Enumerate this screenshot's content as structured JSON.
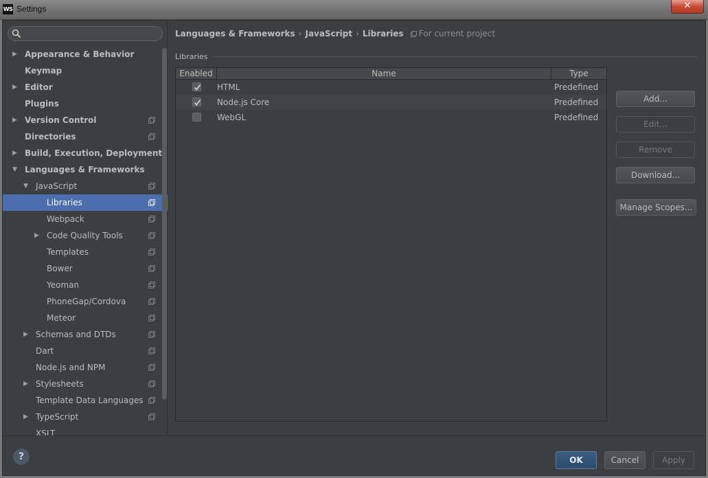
{
  "window": {
    "title": "Settings",
    "logo_text": "WS",
    "close_label": "✕"
  },
  "sidebar": {
    "search_placeholder": "",
    "items": [
      {
        "label": "Appearance & Behavior",
        "level": 0,
        "arrow": "right",
        "bold": true,
        "project": false
      },
      {
        "label": "Keymap",
        "level": 0,
        "arrow": "",
        "bold": true,
        "project": false
      },
      {
        "label": "Editor",
        "level": 0,
        "arrow": "right",
        "bold": true,
        "project": false
      },
      {
        "label": "Plugins",
        "level": 0,
        "arrow": "",
        "bold": true,
        "project": false
      },
      {
        "label": "Version Control",
        "level": 0,
        "arrow": "right",
        "bold": true,
        "project": true
      },
      {
        "label": "Directories",
        "level": 0,
        "arrow": "",
        "bold": true,
        "project": true
      },
      {
        "label": "Build, Execution, Deployment",
        "level": 0,
        "arrow": "right",
        "bold": true,
        "project": false
      },
      {
        "label": "Languages & Frameworks",
        "level": 0,
        "arrow": "down",
        "bold": true,
        "project": false
      },
      {
        "label": "JavaScript",
        "level": 1,
        "arrow": "down",
        "bold": false,
        "project": true
      },
      {
        "label": "Libraries",
        "level": 2,
        "arrow": "",
        "bold": false,
        "project": true,
        "selected": true
      },
      {
        "label": "Webpack",
        "level": 2,
        "arrow": "",
        "bold": false,
        "project": true
      },
      {
        "label": "Code Quality Tools",
        "level": 2,
        "arrow": "right",
        "bold": false,
        "project": true
      },
      {
        "label": "Templates",
        "level": 2,
        "arrow": "",
        "bold": false,
        "project": true
      },
      {
        "label": "Bower",
        "level": 2,
        "arrow": "",
        "bold": false,
        "project": true
      },
      {
        "label": "Yeoman",
        "level": 2,
        "arrow": "",
        "bold": false,
        "project": true
      },
      {
        "label": "PhoneGap/Cordova",
        "level": 2,
        "arrow": "",
        "bold": false,
        "project": true
      },
      {
        "label": "Meteor",
        "level": 2,
        "arrow": "",
        "bold": false,
        "project": true
      },
      {
        "label": "Schemas and DTDs",
        "level": 1,
        "arrow": "right",
        "bold": false,
        "project": true
      },
      {
        "label": "Dart",
        "level": 1,
        "arrow": "",
        "bold": false,
        "project": true
      },
      {
        "label": "Node.js and NPM",
        "level": 1,
        "arrow": "",
        "bold": false,
        "project": true
      },
      {
        "label": "Stylesheets",
        "level": 1,
        "arrow": "right",
        "bold": false,
        "project": true
      },
      {
        "label": "Template Data Languages",
        "level": 1,
        "arrow": "",
        "bold": false,
        "project": true
      },
      {
        "label": "TypeScript",
        "level": 1,
        "arrow": "right",
        "bold": false,
        "project": true
      },
      {
        "label": "XSLT",
        "level": 1,
        "arrow": "",
        "bold": false,
        "project": false
      }
    ]
  },
  "breadcrumb": {
    "parts": [
      "Languages & Frameworks",
      "JavaScript",
      "Libraries"
    ],
    "separator": "›",
    "scope": "For current project"
  },
  "libraries": {
    "section_label": "Libraries",
    "columns": {
      "enabled": "Enabled",
      "name": "Name",
      "type": "Type"
    },
    "rows": [
      {
        "enabled": true,
        "name": "HTML",
        "type": "Predefined"
      },
      {
        "enabled": true,
        "name": "Node.js Core",
        "type": "Predefined"
      },
      {
        "enabled": false,
        "name": "WebGL",
        "type": "Predefined"
      }
    ]
  },
  "side_buttons": {
    "add": "Add...",
    "edit": "Edit...",
    "remove": "Remove",
    "download": "Download...",
    "manage_scopes": "Manage Scopes..."
  },
  "footer": {
    "help": "?",
    "ok": "OK",
    "cancel": "Cancel",
    "apply": "Apply"
  },
  "colors": {
    "selection": "#4b6eaf",
    "background": "#3c3f41"
  }
}
